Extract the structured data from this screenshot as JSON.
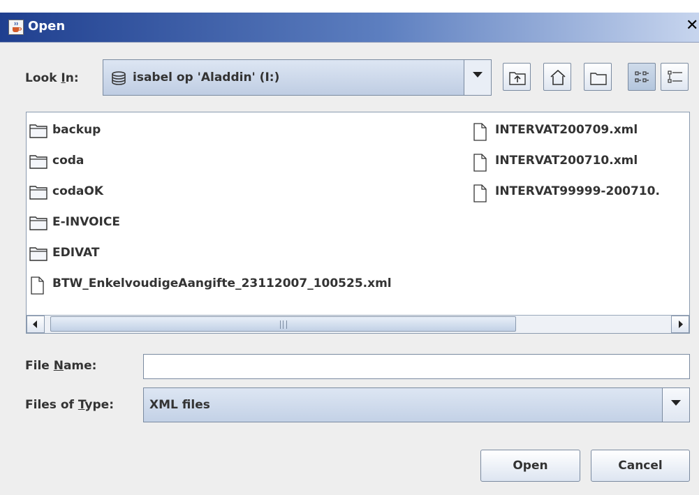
{
  "window": {
    "title": "Open"
  },
  "lookin": {
    "label_pre": "Look ",
    "label_mn": "I",
    "label_post": "n:",
    "value": "isabel op 'Aladdin' (I:)"
  },
  "files_left": [
    {
      "name": "backup",
      "kind": "folder"
    },
    {
      "name": "coda",
      "kind": "folder"
    },
    {
      "name": "codaOK",
      "kind": "folder"
    },
    {
      "name": "E-INVOICE",
      "kind": "folder"
    },
    {
      "name": "EDIVAT",
      "kind": "folder"
    },
    {
      "name": "BTW_EnkelvoudigeAangifte_23112007_100525.xml",
      "kind": "file"
    }
  ],
  "files_right": [
    {
      "name": "INTERVAT200709.xml",
      "kind": "file"
    },
    {
      "name": "INTERVAT200710.xml",
      "kind": "file"
    },
    {
      "name": "INTERVAT99999-200710.",
      "kind": "file"
    }
  ],
  "filename": {
    "label_pre": "File ",
    "label_mn": "N",
    "label_post": "ame:",
    "value": ""
  },
  "filetype": {
    "label_pre": "Files of ",
    "label_mn": "T",
    "label_post": "ype:",
    "value": "XML files"
  },
  "buttons": {
    "open": "Open",
    "cancel": "Cancel"
  },
  "icons": {
    "up": "up-one-level-icon",
    "home": "home-icon",
    "newfolder": "new-folder-icon",
    "list": "list-view-icon",
    "details": "details-view-icon"
  }
}
